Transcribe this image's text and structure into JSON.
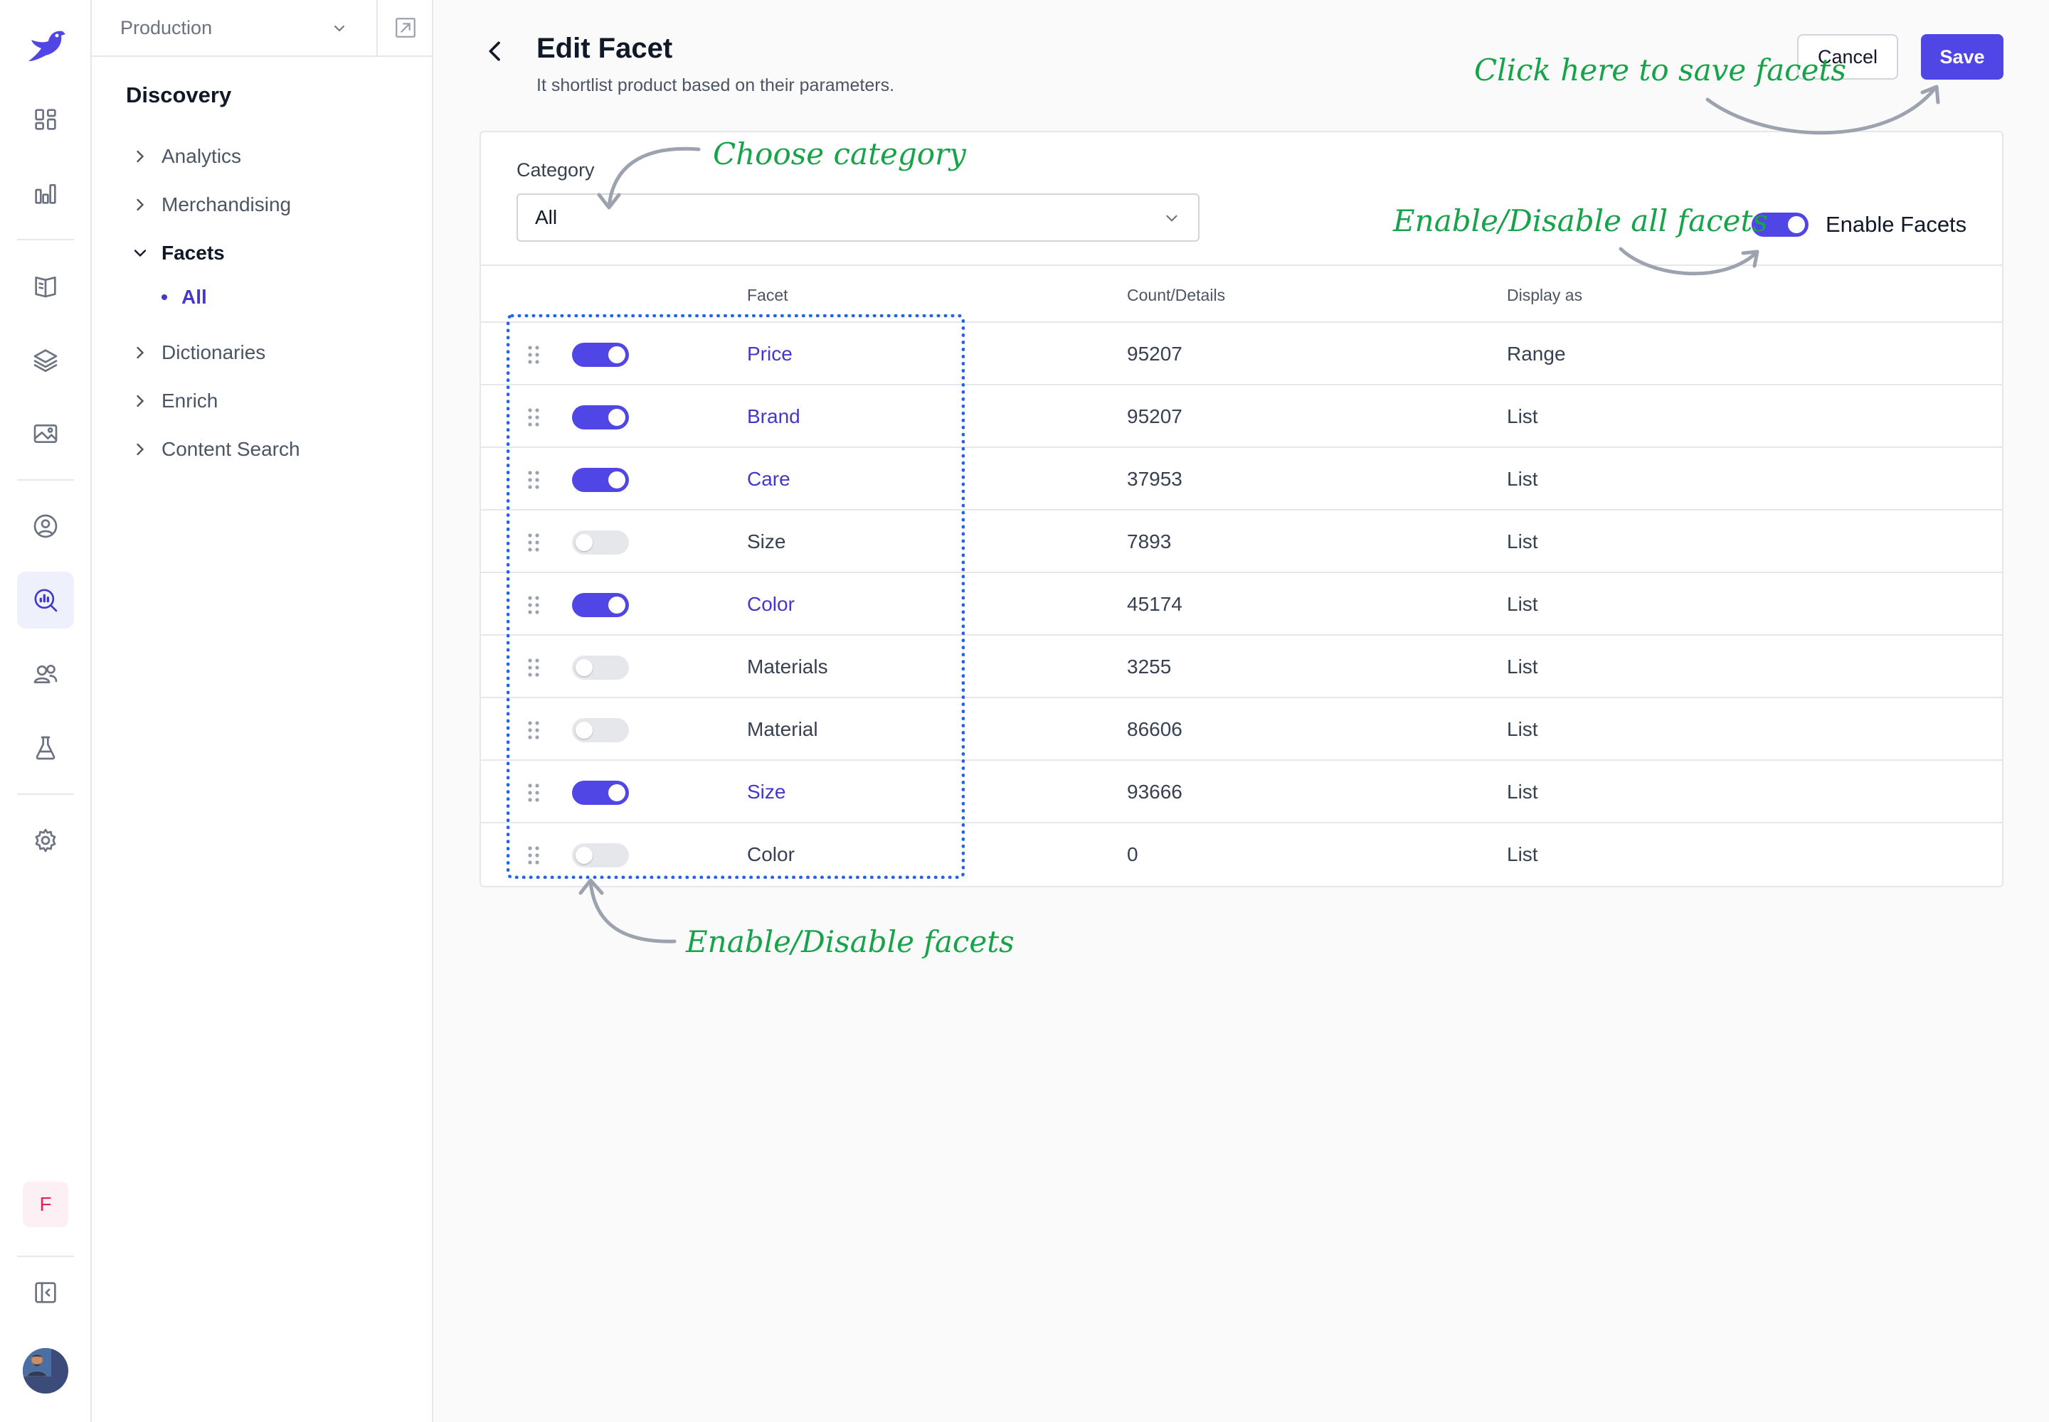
{
  "sidebar": {
    "environment": "Production",
    "title": "Discovery",
    "items": [
      {
        "label": "Analytics",
        "state": "collapsed"
      },
      {
        "label": "Merchandising",
        "state": "collapsed"
      },
      {
        "label": "Facets",
        "state": "expanded",
        "children": [
          {
            "label": "All",
            "active": true
          }
        ]
      },
      {
        "label": "Dictionaries",
        "state": "collapsed"
      },
      {
        "label": "Enrich",
        "state": "collapsed"
      },
      {
        "label": "Content Search",
        "state": "collapsed"
      }
    ]
  },
  "rail": {
    "icons": [
      "logo-bird-icon",
      "dashboard-icon",
      "bar-chart-icon",
      "book-icon",
      "layers-icon",
      "image-icon",
      "user-circle-icon",
      "search-analytics-icon",
      "users-icon",
      "flask-icon",
      "gear-icon",
      "sidebar-collapse-icon"
    ],
    "active": "search-analytics-icon",
    "workspace_badge": "F"
  },
  "header": {
    "title": "Edit Facet",
    "subtitle": "It shortlist product based on their parameters.",
    "cancel_label": "Cancel",
    "save_label": "Save"
  },
  "filters": {
    "category_label": "Category",
    "category_value": "All",
    "enable_all_label": "Enable Facets",
    "enable_all_on": true
  },
  "table": {
    "columns": [
      "Facet",
      "Count/Details",
      "Display as"
    ],
    "rows": [
      {
        "facet": "Price",
        "count": "95207",
        "display": "Range",
        "enabled": true
      },
      {
        "facet": "Brand",
        "count": "95207",
        "display": "List",
        "enabled": true
      },
      {
        "facet": "Care",
        "count": "37953",
        "display": "List",
        "enabled": true
      },
      {
        "facet": "Size",
        "count": "7893",
        "display": "List",
        "enabled": false
      },
      {
        "facet": "Color",
        "count": "45174",
        "display": "List",
        "enabled": true
      },
      {
        "facet": "Materials",
        "count": "3255",
        "display": "List",
        "enabled": false
      },
      {
        "facet": "Material",
        "count": "86606",
        "display": "List",
        "enabled": false
      },
      {
        "facet": "Size",
        "count": "93666",
        "display": "List",
        "enabled": true
      },
      {
        "facet": "Color",
        "count": "0",
        "display": "List",
        "enabled": false
      }
    ]
  },
  "annotations": {
    "save_hint": "Click here to save facets",
    "category_hint": "Choose category",
    "enable_all_hint": "Enable/Disable all facets",
    "facets_hint": "Enable/Disable facets"
  },
  "colors": {
    "accent": "#4f46e5",
    "accent_text": "#4338ca",
    "annotation": "#17a34a",
    "annotation_box": "#2563eb"
  }
}
